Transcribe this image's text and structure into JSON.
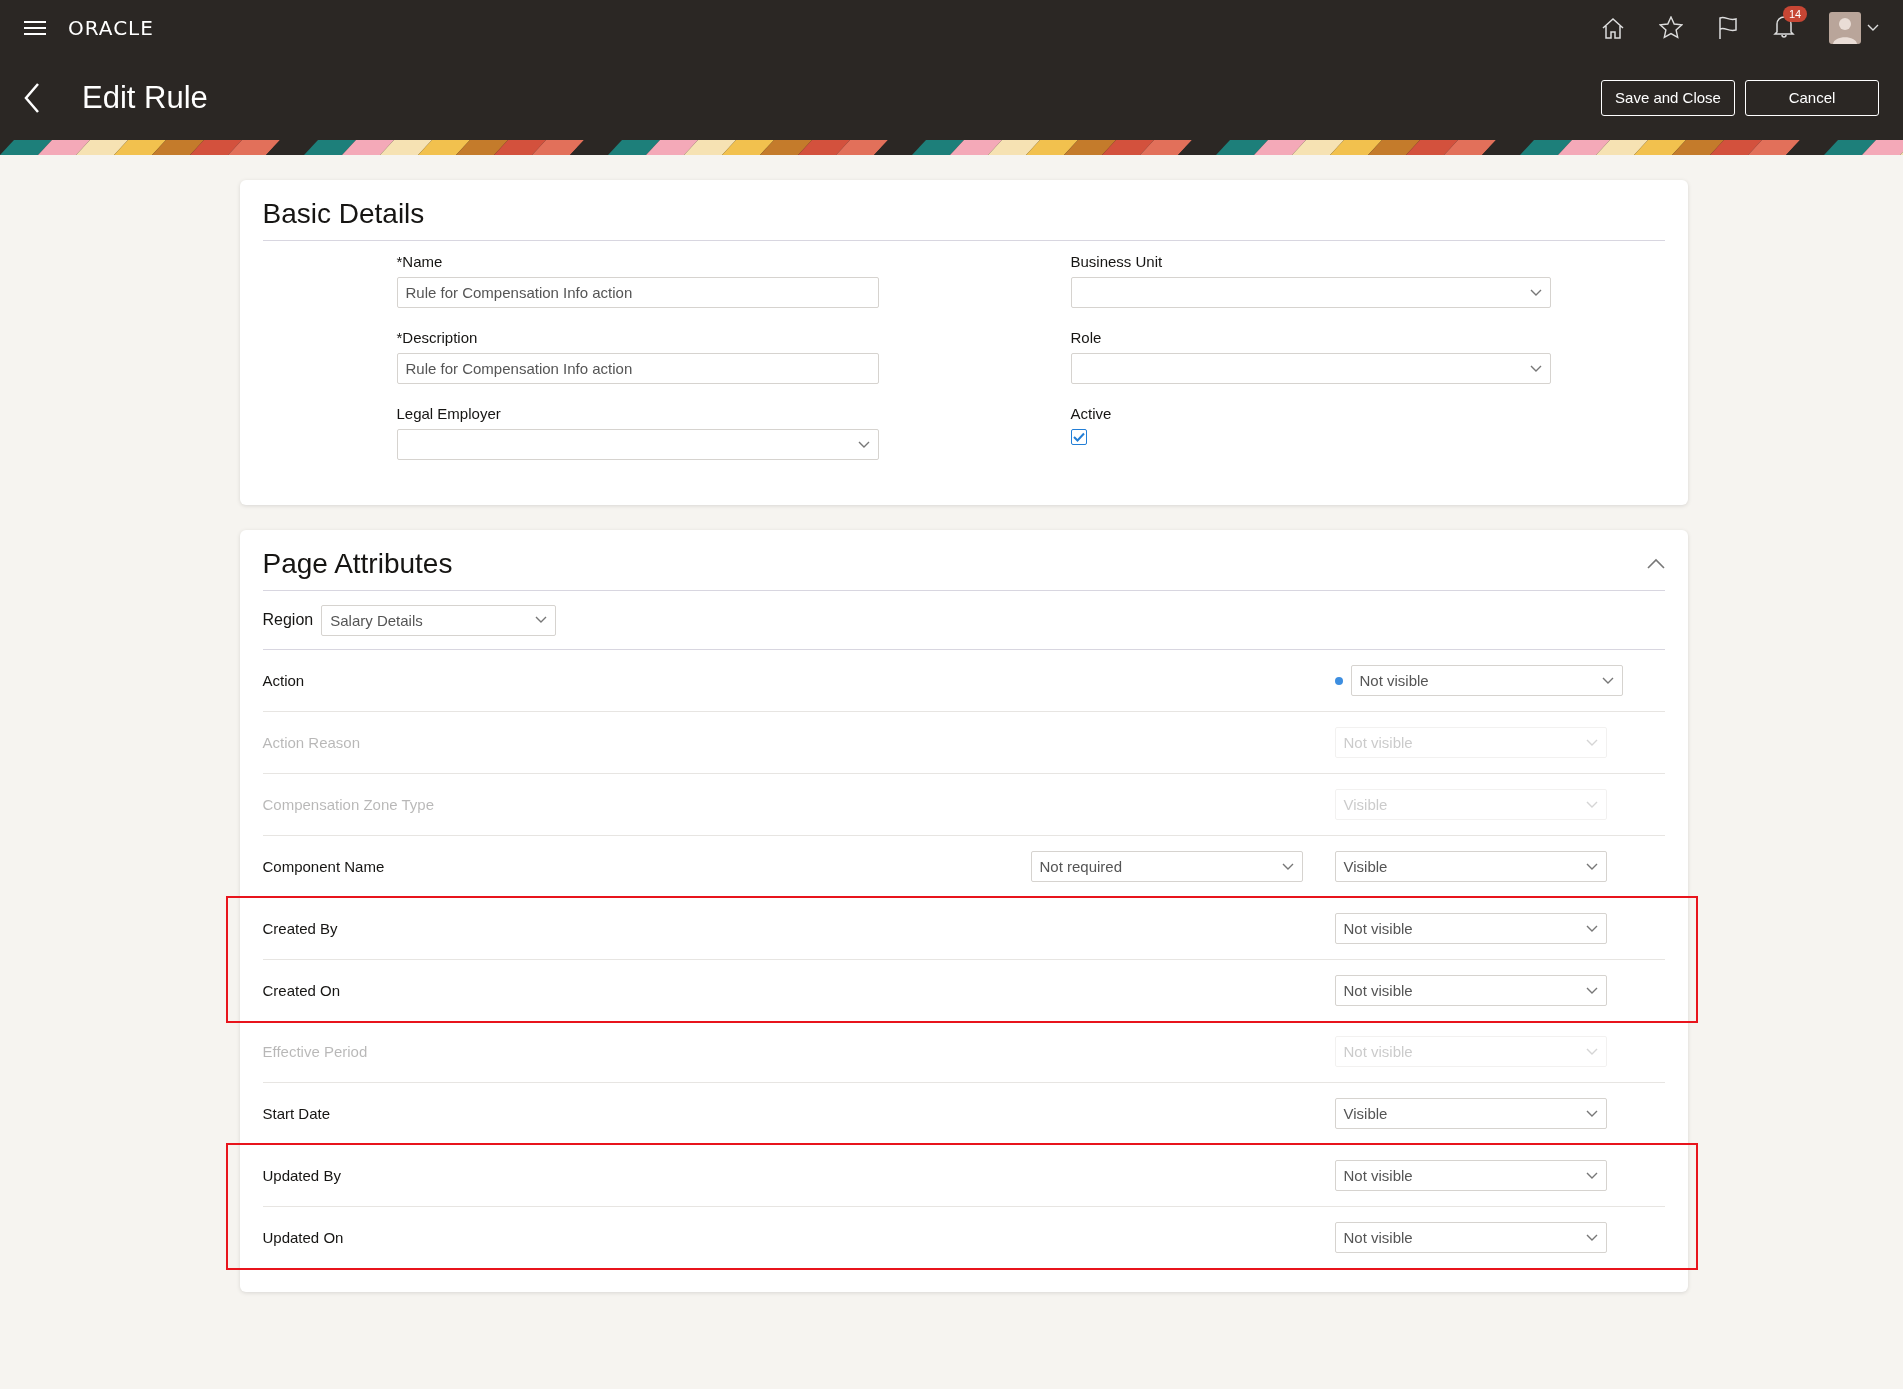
{
  "header": {
    "logo": "ORACLE",
    "notification_count": "14",
    "title": "Edit Rule",
    "buttons": [
      {
        "label": "Save and Close"
      },
      {
        "label": "Cancel"
      }
    ]
  },
  "basic_details": {
    "title": "Basic Details",
    "columns": [
      [
        {
          "kind": "text",
          "label": "*Name",
          "value": "Rule for Compensation Info action"
        },
        {
          "kind": "text",
          "label": "*Description",
          "value": "Rule for Compensation Info action"
        },
        {
          "kind": "select",
          "label": "Legal Employer"
        }
      ],
      [
        {
          "kind": "select",
          "label": "Business Unit"
        },
        {
          "kind": "select",
          "label": "Role"
        },
        {
          "kind": "checkbox",
          "label": "Active",
          "checked": true
        }
      ]
    ]
  },
  "page_attributes": {
    "title": "Page Attributes",
    "expanded": true,
    "region": {
      "label": "Region",
      "value": "Salary Details"
    },
    "groups": [
      {
        "highlighted": false,
        "rows": [
          {
            "label": "Action",
            "changed": true,
            "faded": false,
            "visibility": "Not visible"
          },
          {
            "label": "Action Reason",
            "changed": false,
            "faded": true,
            "visibility": "Not visible"
          },
          {
            "label": "Compensation Zone Type",
            "changed": false,
            "faded": true,
            "visibility": "Visible"
          },
          {
            "label": "Component Name",
            "changed": false,
            "faded": false,
            "requirement": "Not required",
            "visibility": "Visible"
          }
        ]
      },
      {
        "highlighted": true,
        "rows": [
          {
            "label": "Created By",
            "changed": false,
            "faded": false,
            "visibility": "Not visible"
          },
          {
            "label": "Created On",
            "changed": false,
            "faded": false,
            "visibility": "Not visible"
          }
        ]
      },
      {
        "highlighted": false,
        "rows": [
          {
            "label": "Effective Period",
            "changed": false,
            "faded": true,
            "visibility": "Not visible"
          },
          {
            "label": "Start Date",
            "changed": false,
            "faded": false,
            "visibility": "Visible"
          }
        ]
      },
      {
        "highlighted": true,
        "rows": [
          {
            "label": "Updated By",
            "changed": false,
            "faded": false,
            "visibility": "Not visible"
          },
          {
            "label": "Updated On",
            "changed": false,
            "faded": false,
            "visibility": "Not visible"
          }
        ]
      }
    ]
  }
}
